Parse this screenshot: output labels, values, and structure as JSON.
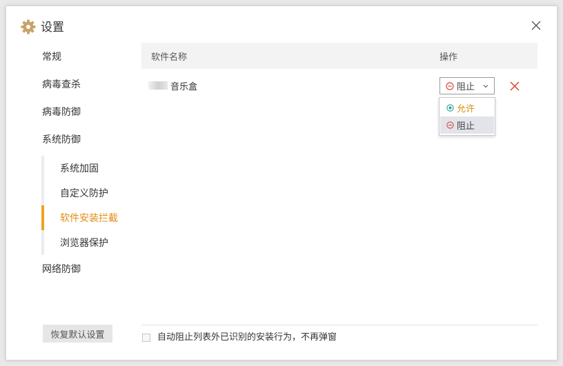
{
  "window": {
    "title": "设置",
    "title_icon": "gear-icon",
    "close_icon": "close-icon",
    "accent_color": "#f0a020"
  },
  "sidebar": {
    "items": [
      {
        "label": "常规"
      },
      {
        "label": "病毒查杀"
      },
      {
        "label": "病毒防御"
      },
      {
        "label": "系统防御"
      },
      {
        "label": "网络防御"
      }
    ],
    "sub_items": [
      {
        "label": "系统加固",
        "active": false
      },
      {
        "label": "自定义防护",
        "active": false
      },
      {
        "label": "软件安装拦截",
        "active": true
      },
      {
        "label": "浏览器保护",
        "active": false
      }
    ],
    "restore_button": "恢复默认设置"
  },
  "table": {
    "columns": [
      "软件名称",
      "操作"
    ],
    "rows": [
      {
        "name": "音乐盒",
        "action": "阻止",
        "delete_icon": "delete-x-icon"
      }
    ]
  },
  "dropdown": {
    "options": [
      {
        "label": "允许",
        "icon": "allow-radio-icon",
        "color": "#d88c0a"
      },
      {
        "label": "阻止",
        "icon": "block-circle-icon",
        "color": "#444444"
      }
    ]
  },
  "footer": {
    "checkbox_label": "自动阻止列表外已识别的安装行为，不再弹窗",
    "checked": false
  }
}
